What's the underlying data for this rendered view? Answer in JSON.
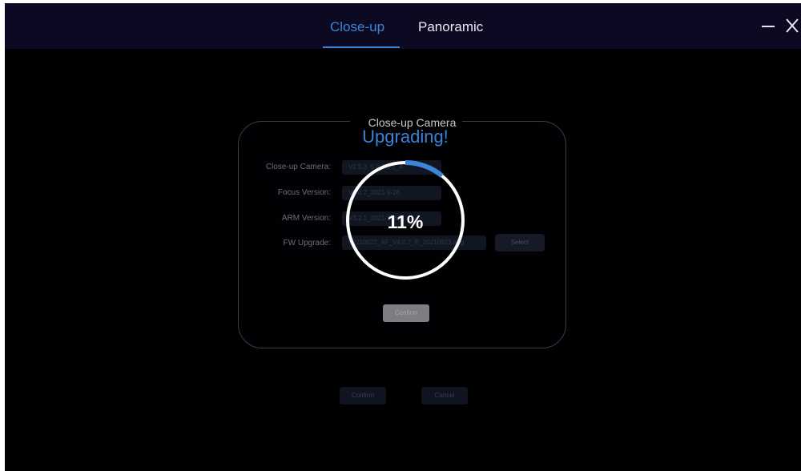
{
  "tabs": [
    {
      "label": "Close-up",
      "active": true
    },
    {
      "label": "Panoramic",
      "active": false
    }
  ],
  "window_controls": {
    "minimize_icon": "minus",
    "close_icon": "x"
  },
  "panel": {
    "title": "Close-up Camera",
    "fields": [
      {
        "label": "Close-up Camera:",
        "value": "V2.5.3_5.0.0.0.1_4"
      },
      {
        "label": "Focus Version:",
        "value": "V5.0.7_2021-9-28"
      },
      {
        "label": "ARM Version:",
        "value": "V3.2.1_2021-9-28"
      },
      {
        "label": "FW Upgrade:",
        "value": "V2110922_AF_V4.0.7_R_20210923.mrg"
      }
    ],
    "select_label": "Select",
    "confirm_label": "Confirm"
  },
  "footer": {
    "confirm_label": "Confirm",
    "cancel_label": "Cancel"
  },
  "upgrade_overlay": {
    "status": "Upgrading!",
    "percent_text": "11%",
    "progress": 0.11
  },
  "colors": {
    "accent": "#3a86d8",
    "background": "#000000",
    "titlebar": "#0b0a22",
    "ring": "#ffffff"
  }
}
